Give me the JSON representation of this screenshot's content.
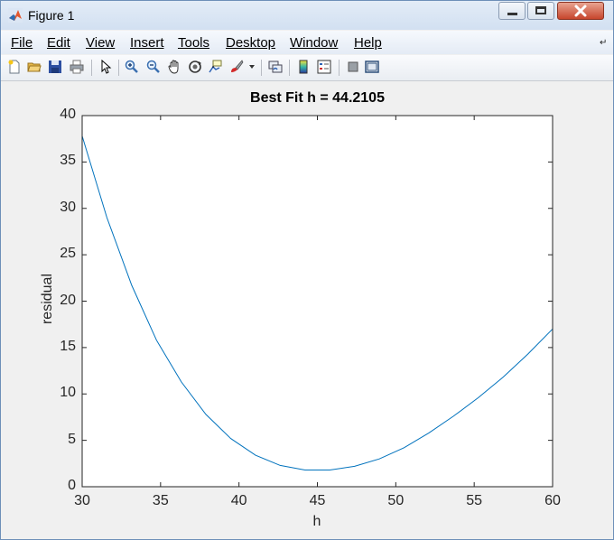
{
  "window": {
    "title": "Figure 1"
  },
  "menu": [
    "File",
    "Edit",
    "View",
    "Insert",
    "Tools",
    "Desktop",
    "Window",
    "Help"
  ],
  "toolbar_icons": [
    "new-figure-icon",
    "open-file-icon",
    "save-icon",
    "print-icon",
    "pointer-icon",
    "zoom-in-icon",
    "zoom-out-icon",
    "pan-icon",
    "rotate-3d-icon",
    "data-cursor-icon",
    "brush-icon",
    "link-plot-icon",
    "colorbar-icon",
    "legend-icon",
    "hide-plot-tools-icon",
    "show-plot-tools-icon"
  ],
  "colors": {
    "line": "#0072bd",
    "axes": "#262626"
  },
  "chart_data": {
    "type": "line",
    "title": "Best Fit h = 44.2105",
    "xlabel": "h",
    "ylabel": "residual",
    "xlim": [
      30,
      60
    ],
    "ylim": [
      0,
      40
    ],
    "xticks": [
      "30",
      "35",
      "40",
      "45",
      "50",
      "55",
      "60"
    ],
    "yticks": [
      "0",
      "5",
      "10",
      "15",
      "20",
      "25",
      "30",
      "35",
      "40"
    ],
    "grid": false,
    "series": [
      {
        "x": [
          30,
          31.58,
          33.16,
          34.74,
          36.32,
          37.89,
          39.47,
          41.05,
          42.63,
          44.21,
          45.79,
          47.37,
          48.95,
          50.53,
          52.11,
          53.68,
          55.26,
          56.84,
          58.42,
          60
        ],
        "y": [
          37.8,
          29.0,
          21.7,
          15.8,
          11.3,
          7.8,
          5.2,
          3.4,
          2.3,
          1.8,
          1.8,
          2.2,
          3.0,
          4.2,
          5.8,
          7.6,
          9.6,
          11.8,
          14.3,
          17.0
        ]
      }
    ]
  }
}
